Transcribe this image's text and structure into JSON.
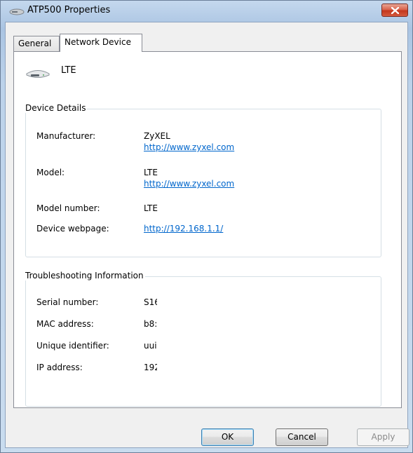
{
  "window": {
    "title": "ATP500 Properties",
    "close_label": "close"
  },
  "tabs": [
    {
      "label": "General",
      "active": false
    },
    {
      "label": "Network Device",
      "active": true
    }
  ],
  "device": {
    "name": "LTE",
    "icon": "router-device-icon"
  },
  "device_details": {
    "title": "Device Details",
    "manufacturer_label": "Manufacturer:",
    "manufacturer_value": "ZyXEL",
    "manufacturer_url": "http://www.zyxel.com",
    "model_label": "Model:",
    "model_value": "LTE",
    "model_url": "http://www.zyxel.com",
    "model_number_label": "Model number:",
    "model_number_value": "LTE",
    "webpage_label": "Device webpage:",
    "webpage_url": "http://192.168.1.1/"
  },
  "troubleshooting": {
    "title": "Troubleshooting Information",
    "serial_label": "Serial number:",
    "serial_value": "S16",
    "mac_label": "MAC address:",
    "mac_value": "b8:",
    "uid_label": "Unique identifier:",
    "uid_value": "uui",
    "ip_label": "IP address:",
    "ip_value": "192"
  },
  "buttons": {
    "ok": "OK",
    "cancel": "Cancel",
    "apply": "Apply"
  },
  "colors": {
    "link": "#0066cc",
    "close_button": "#c4361c",
    "frame": "#aac4e2"
  }
}
